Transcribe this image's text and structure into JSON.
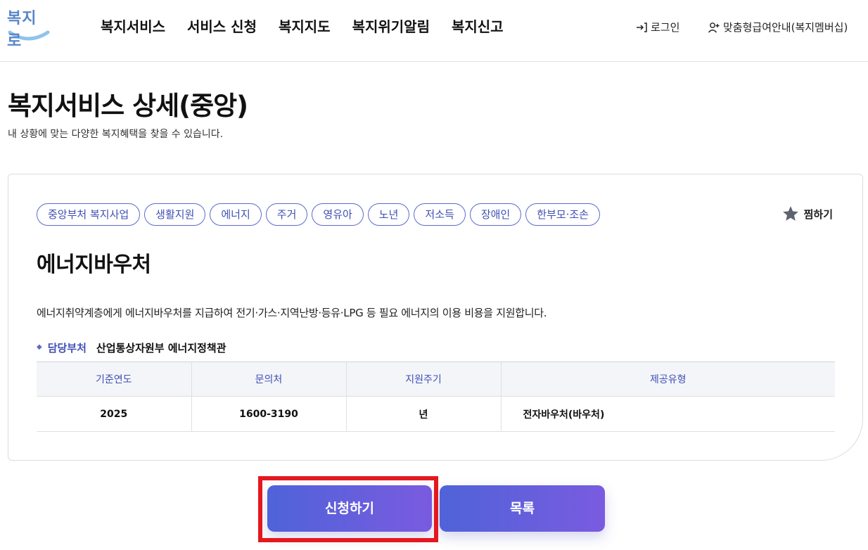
{
  "header": {
    "logo_text": "복지로",
    "nav": [
      "복지서비스",
      "서비스 신청",
      "복지지도",
      "복지위기알림",
      "복지신고"
    ],
    "login_label": "로그인",
    "membership_label": "맞춤형급여안내(복지멤버십)"
  },
  "page": {
    "title": "복지서비스 상세(중앙)",
    "subtitle": "내 상황에 맞는 다양한 복지혜택을 찾을 수 있습니다."
  },
  "service": {
    "tags": [
      "중앙부처 복지사업",
      "생활지원",
      "에너지",
      "주거",
      "영유아",
      "노년",
      "저소득",
      "장애인",
      "한부모·조손"
    ],
    "favorite_label": "찜하기",
    "title": "에너지바우처",
    "description": "에너지취약계층에게 에너지바우처를 지급하여 전기·가스·지역난방·등유·LPG 등 필요 에너지의 이용 비용을 지원합니다.",
    "department_label": "담당부처",
    "department_value": "산업통상자원부 에너지정책관",
    "table": {
      "headers": [
        "기준연도",
        "문의처",
        "지원주기",
        "제공유형"
      ],
      "row": [
        "2025",
        "1600-3190",
        "년",
        "전자바우처(바우처)"
      ]
    }
  },
  "actions": {
    "apply_label": "신청하기",
    "list_label": "목록"
  },
  "colors": {
    "accent": "#5b6bc9",
    "button_gradient_start": "#4f63d8",
    "button_gradient_end": "#7a5be0",
    "highlight": "#e3191e"
  }
}
